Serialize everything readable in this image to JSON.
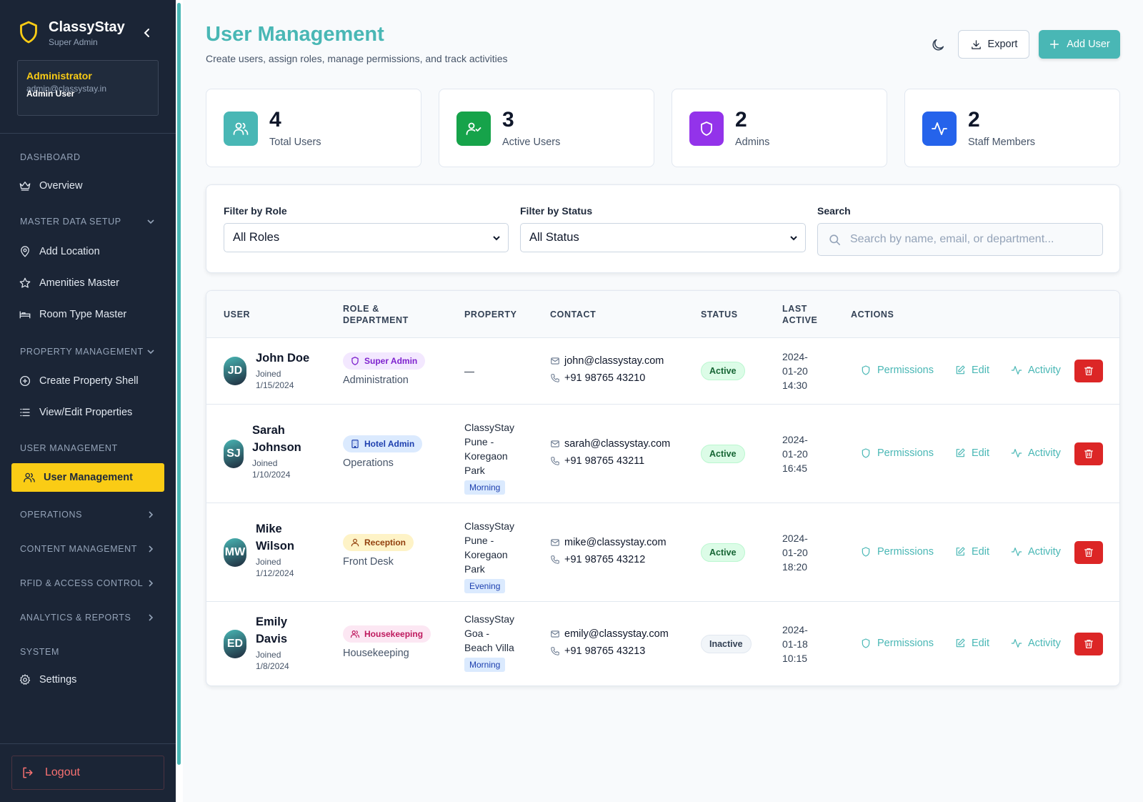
{
  "sidebar": {
    "brand": "ClassyStay",
    "brand_sub": "Super Admin",
    "account": {
      "role": "Administrator",
      "name": "Admin User",
      "email": "admin@classystay.in"
    },
    "sections": {
      "dashboard": "DASHBOARD",
      "master": "MASTER DATA SETUP",
      "property": "PROPERTY MANAGEMENT",
      "users": "USER MANAGEMENT",
      "operations": "OPERATIONS",
      "content": "CONTENT MANAGEMENT",
      "rfid": "RFID & ACCESS CONTROL",
      "analytics": "ANALYTICS & REPORTS",
      "system": "SYSTEM"
    },
    "items": {
      "overview": "Overview",
      "add_location": "Add Location",
      "amenities": "Amenities Master",
      "room_type": "Room Type Master",
      "create_property": "Create Property Shell",
      "view_properties": "View/Edit Properties",
      "user_management": "User Management",
      "settings": "Settings"
    },
    "logout": "Logout"
  },
  "header": {
    "title": "User Management",
    "subtitle": "Create users, assign roles, manage permissions, and track activities",
    "export": "Export",
    "add_user": "Add User"
  },
  "stats": [
    {
      "value": "4",
      "label": "Total Users",
      "color": "#49b7b5"
    },
    {
      "value": "3",
      "label": "Active Users",
      "color": "#16a34a"
    },
    {
      "value": "2",
      "label": "Admins",
      "color": "#9333ea"
    },
    {
      "value": "2",
      "label": "Staff Members",
      "color": "#2563eb"
    }
  ],
  "filters": {
    "role_label": "Filter by Role",
    "role_value": "All Roles",
    "status_label": "Filter by Status",
    "status_value": "All Status",
    "search_label": "Search",
    "search_placeholder": "Search by name, email, or department..."
  },
  "table": {
    "columns": {
      "user": "USER",
      "role1": "ROLE &",
      "role2": "DEPARTMENT",
      "property": "PROPERTY",
      "contact": "CONTACT",
      "status": "STATUS",
      "last1": "LAST",
      "last2": "ACTIVE",
      "actions": "ACTIONS"
    },
    "actions": {
      "permissions": "Permissions",
      "edit": "Edit",
      "activity": "Activity"
    },
    "rows": [
      {
        "initials": "JD",
        "name1": "John Doe",
        "name2": "",
        "joined1": "Joined",
        "joined2": "1/15/2024",
        "role": "Super Admin",
        "department": "Administration",
        "property": [
          "—"
        ],
        "shift": "",
        "email": "john@classystay.com",
        "phone": "+91 98765 43210",
        "status": "Active",
        "last": [
          "2024-",
          "01-20",
          "14:30"
        ]
      },
      {
        "initials": "SJ",
        "name1": "Sarah",
        "name2": "Johnson",
        "joined1": "Joined",
        "joined2": "1/10/2024",
        "role": "Hotel Admin",
        "department": "Operations",
        "property": [
          "ClassyStay",
          "Pune -",
          "Koregaon",
          "Park"
        ],
        "shift": "Morning",
        "email": "sarah@classystay.com",
        "phone": "+91 98765 43211",
        "status": "Active",
        "last": [
          "2024-",
          "01-20",
          "16:45"
        ]
      },
      {
        "initials": "MW",
        "name1": "Mike",
        "name2": "Wilson",
        "joined1": "Joined",
        "joined2": "1/12/2024",
        "role": "Reception",
        "department": "Front Desk",
        "property": [
          "ClassyStay",
          "Pune -",
          "Koregaon",
          "Park"
        ],
        "shift": "Evening",
        "email": "mike@classystay.com",
        "phone": "+91 98765 43212",
        "status": "Active",
        "last": [
          "2024-",
          "01-20",
          "18:20"
        ]
      },
      {
        "initials": "ED",
        "name1": "Emily",
        "name2": "Davis",
        "joined1": "Joined",
        "joined2": "1/8/2024",
        "role": "Housekeeping",
        "department": "Housekeeping",
        "property": [
          "ClassyStay",
          "Goa -",
          "Beach Villa"
        ],
        "shift": "Morning",
        "email": "emily@classystay.com",
        "phone": "+91 98765 43213",
        "status": "Inactive",
        "last": [
          "2024-",
          "01-18",
          "10:15"
        ]
      }
    ]
  }
}
